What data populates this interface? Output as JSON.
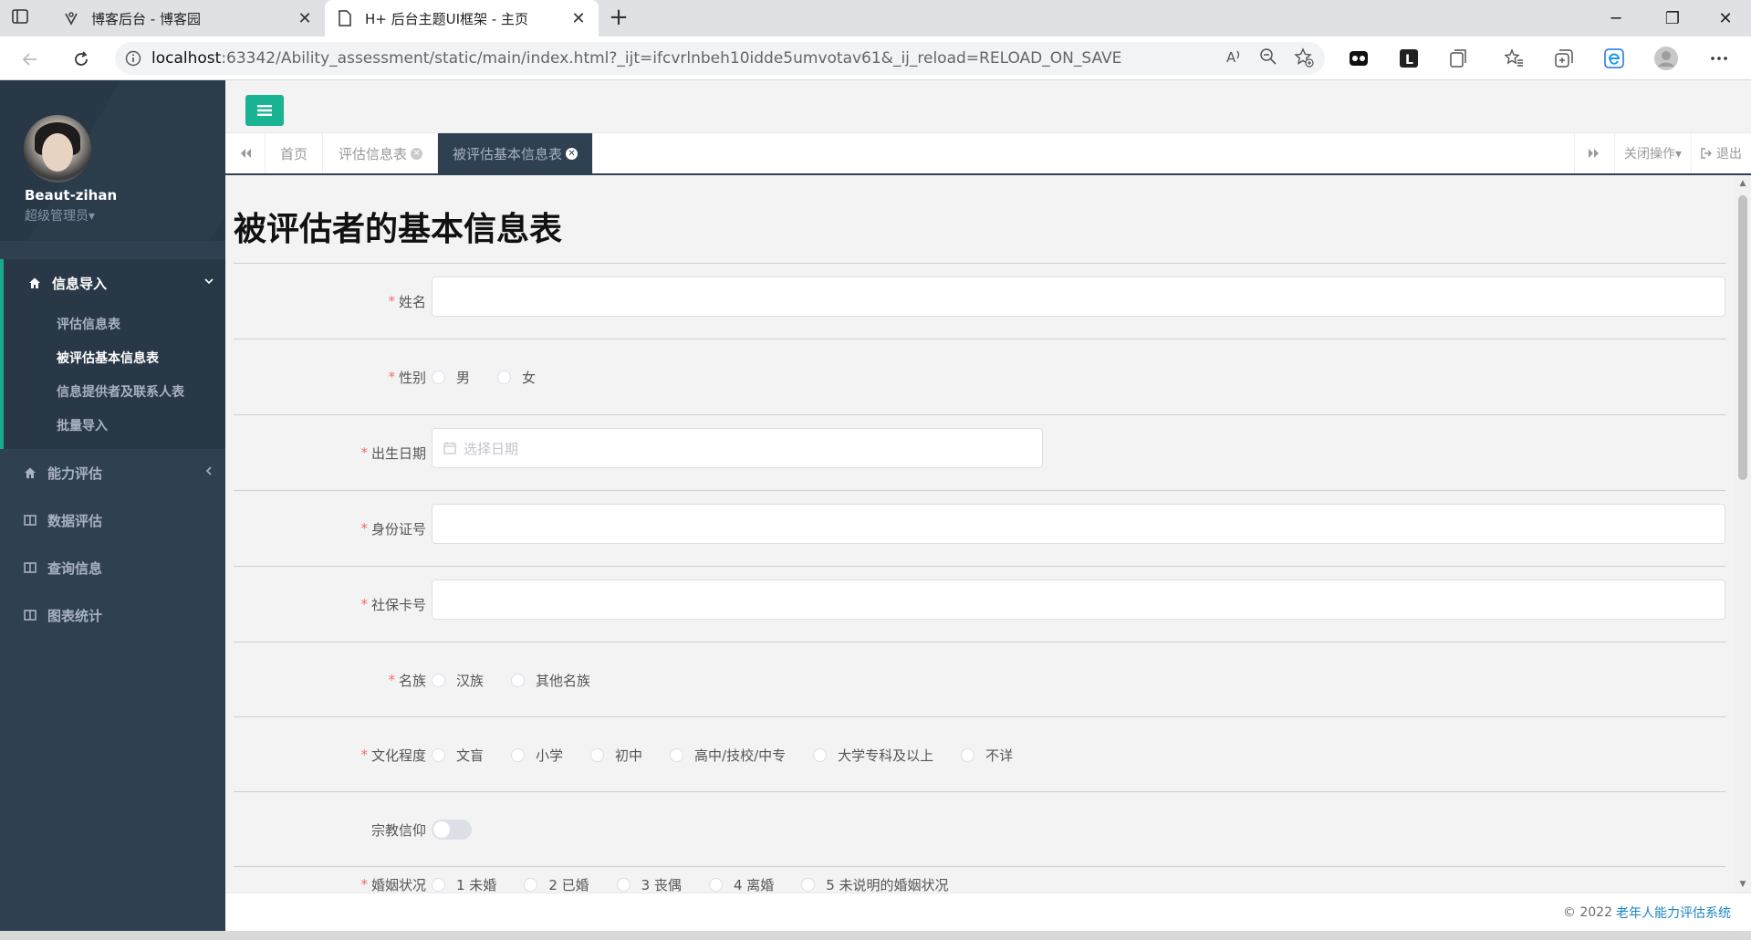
{
  "browser": {
    "tabs": [
      {
        "label": "博客后台 - 博客园",
        "close": "✕"
      },
      {
        "label": "H+ 后台主题UI框架 - 主页",
        "close": "✕"
      }
    ],
    "new_tab": "+",
    "url_host": "localhost",
    "url_rest": ":63342/Ability_assessment/static/main/index.html?_ijt=ifcvrlnbeh10idde5umvotav61&_ij_reload=RELOAD_ON_SAVE",
    "window_controls": {
      "minimize": "─",
      "maximize": "❐",
      "close": "✕"
    }
  },
  "sidebar": {
    "user_name": "Beaut-zihan",
    "user_role": "超级管理员▾",
    "groups": [
      {
        "label": "信息导入",
        "icon": "home-icon",
        "chevron": "⌄",
        "items": [
          "评估信息表",
          "被评估基本信息表",
          "信息提供者及联系人表",
          "批量导入"
        ]
      },
      {
        "label": "能力评估",
        "icon": "home-icon",
        "chevron": "‹"
      },
      {
        "label": "数据评估",
        "icon": "columns-icon"
      },
      {
        "label": "查询信息",
        "icon": "columns-icon"
      },
      {
        "label": "图表统计",
        "icon": "columns-icon"
      }
    ]
  },
  "page_tabs": {
    "tabs": [
      {
        "label": "首页"
      },
      {
        "label": "评估信息表"
      },
      {
        "label": "被评估基本信息表"
      }
    ],
    "close_ops": "关闭操作▾",
    "logout": "退出"
  },
  "form": {
    "title": "被评估者的基本信息表",
    "required_mark": "*",
    "fields": {
      "name": {
        "label": "姓名"
      },
      "gender": {
        "label": "性别",
        "options": [
          "男",
          "女"
        ]
      },
      "birthdate": {
        "label": "出生日期",
        "placeholder": "选择日期"
      },
      "id_number": {
        "label": "身份证号"
      },
      "social_card": {
        "label": "社保卡号"
      },
      "ethnicity": {
        "label": "名族",
        "options": [
          "汉族",
          "其他名族"
        ]
      },
      "education": {
        "label": "文化程度",
        "options": [
          "文盲",
          "小学",
          "初中",
          "高中/技校/中专",
          "大学专科及以上",
          "不详"
        ]
      },
      "religion": {
        "label": "宗教信仰"
      },
      "marital": {
        "label": "婚姻状况",
        "options": [
          "1 未婚",
          "2 已婚",
          "3 丧偶",
          "4 离婚",
          "5 未说明的婚姻状况"
        ]
      }
    }
  },
  "footer": {
    "copyright": "© 2022",
    "system_name": "老年人能力评估系统"
  }
}
